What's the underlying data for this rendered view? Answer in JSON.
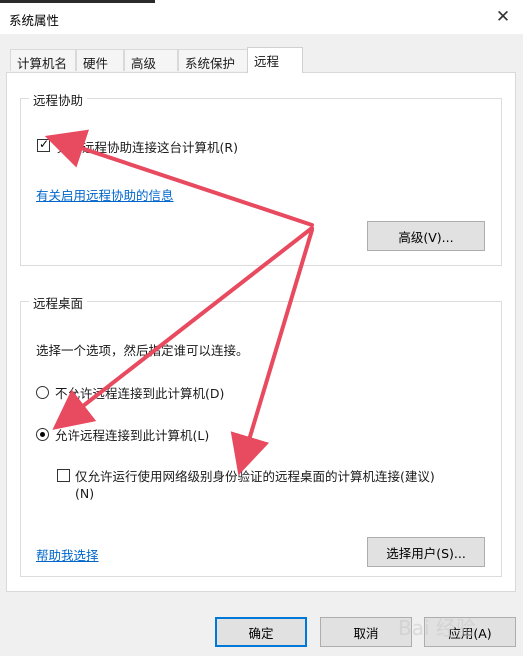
{
  "window": {
    "title": "系统属性",
    "close_glyph": "✕"
  },
  "tabs": [
    {
      "label": "计算机名",
      "active": false
    },
    {
      "label": "硬件",
      "active": false
    },
    {
      "label": "高级",
      "active": false
    },
    {
      "label": "系统保护",
      "active": false
    },
    {
      "label": "远程",
      "active": true
    }
  ],
  "remote_assistance": {
    "title": "远程协助",
    "allow_checkbox_label": "允许远程协助连接这台计算机(R)",
    "allow_checked": true,
    "info_link": "有关启用远程协助的信息",
    "advanced_button": "高级(V)..."
  },
  "remote_desktop": {
    "title": "远程桌面",
    "instruction": "选择一个选项，然后指定谁可以连接。",
    "option_deny": "不允许远程连接到此计算机(D)",
    "option_allow": "允许远程连接到此计算机(L)",
    "selected_option": "allow",
    "nla_checkbox_label_line1": "仅允许运行使用网络级别身份验证的远程桌面的计算机连接(建议)",
    "nla_checkbox_label_line2": "(N)",
    "nla_checked": false,
    "help_link": "帮助我选择",
    "select_users_button": "选择用户(S)..."
  },
  "footer": {
    "ok_button": "确定",
    "cancel_button": "取消",
    "apply_button": "应用(A)"
  },
  "annotation": {
    "arrow_color": "#e84a5f"
  },
  "watermark": "Bai 经验"
}
